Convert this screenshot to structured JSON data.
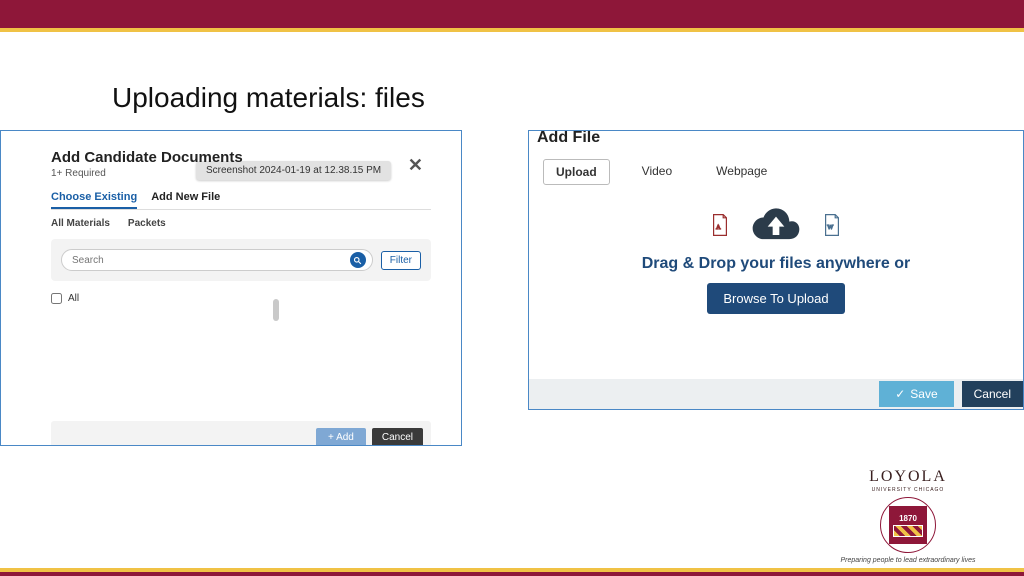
{
  "slide": {
    "title": "Uploading materials: files"
  },
  "leftModal": {
    "title": "Add Candidate Documents",
    "subtitle": "1+ Required",
    "tooltip": "Screenshot 2024-01-19 at 12.38.15 PM",
    "tabs1": {
      "choose": "Choose Existing",
      "addnew": "Add New File"
    },
    "tabs2": {
      "all": "All Materials",
      "packets": "Packets"
    },
    "searchPlaceholder": "Search",
    "filter": "Filter",
    "allLabel": "All",
    "addBtn": "+ Add",
    "cancelBtn": "Cancel"
  },
  "rightModal": {
    "title": "Add File",
    "tabs": {
      "upload": "Upload",
      "video": "Video",
      "webpage": "Webpage"
    },
    "dropText": "Drag & Drop your files anywhere or",
    "browse": "Browse To Upload",
    "save": "Save",
    "cancel": "Cancel"
  },
  "branding": {
    "name": "LOYOLA",
    "sub": "UNIVERSITY CHICAGO",
    "year": "1870",
    "tagline": "Preparing people to lead extraordinary lives"
  }
}
